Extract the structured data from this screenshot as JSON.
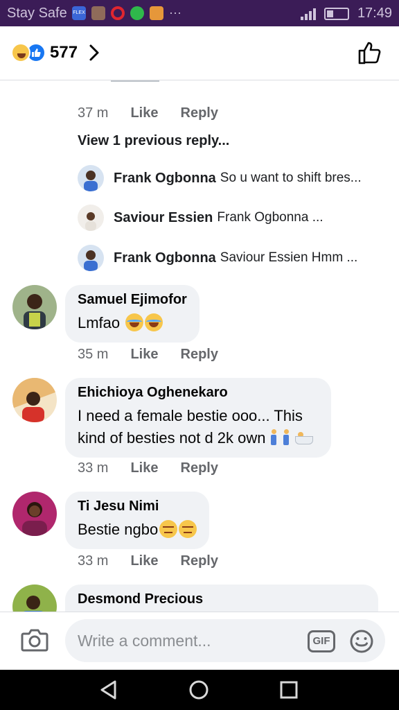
{
  "status_bar": {
    "carrier": "Stay Safe",
    "time": "17:49",
    "notification_icons": [
      "flex-app-icon",
      "photo-icon",
      "opera-icon",
      "whatsapp-icon",
      "notes-icon",
      "more-icon"
    ],
    "more": "···"
  },
  "header": {
    "reaction_count": "577",
    "reactions": [
      "haha",
      "like"
    ]
  },
  "thread": {
    "parent_meta": {
      "time": "37 m",
      "like": "Like",
      "reply": "Reply"
    },
    "view_previous": "View 1 previous reply...",
    "replies": [
      {
        "name": "Frank Ogbonna",
        "text": "So u want to shift bres..."
      },
      {
        "name": "Saviour Essien",
        "text": "Frank Ogbonna ..."
      },
      {
        "name": "Frank Ogbonna",
        "text": "Saviour Essien Hmm ..."
      }
    ]
  },
  "comments": [
    {
      "name": "Samuel Ejimofor",
      "text": "Lmfao",
      "time": "35 m",
      "like": "Like",
      "reply": "Reply"
    },
    {
      "name": "Ehichioya Oghenekaro",
      "line1": "I need a female bestie ooo... This",
      "line2": "kind of besties not d 2k own",
      "time": "33 m",
      "like": "Like",
      "reply": "Reply"
    },
    {
      "name": "Ti Jesu Nimi",
      "text": "Bestie ngbo",
      "time": "33 m",
      "like": "Like",
      "reply": "Reply"
    },
    {
      "name": "Desmond Precious"
    }
  ],
  "composer": {
    "placeholder": "Write a comment...",
    "gif_label": "GIF"
  },
  "colors": {
    "status_bar": "#3b1c57",
    "bubble": "#f0f2f5",
    "like_blue": "#1877f2",
    "meta_gray": "#65676b"
  }
}
